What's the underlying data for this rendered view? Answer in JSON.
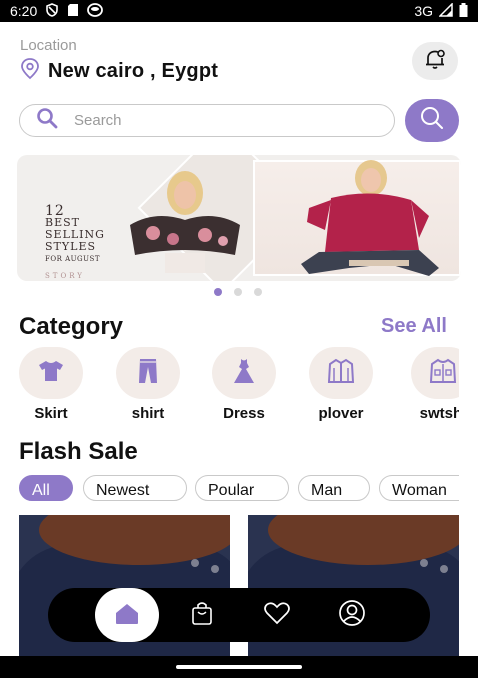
{
  "status_bar": {
    "time": "6:20",
    "network": "3G"
  },
  "header": {
    "location_label": "Location",
    "location_value": "New cairo , Eygpt"
  },
  "search": {
    "placeholder": "Search"
  },
  "banner": {
    "line1": "12",
    "line2": "BEST",
    "line3": "SELLING",
    "line4": "STYLES",
    "line5": "FOR AUGUST",
    "brand": "STORY",
    "slide_count": 3,
    "active_slide": 1
  },
  "category": {
    "title": "Category",
    "see_all": "See All",
    "items": [
      {
        "label": "Skirt",
        "icon": "tshirt-icon"
      },
      {
        "label": "shirt",
        "icon": "pants-icon"
      },
      {
        "label": "Dress",
        "icon": "dress-icon"
      },
      {
        "label": "plover",
        "icon": "jacket-icon"
      },
      {
        "label": "swtshi",
        "icon": "sweatshirt-icon"
      }
    ]
  },
  "flash_sale": {
    "title": "Flash Sale",
    "filters": [
      "All",
      "Newest",
      "Poular",
      "Man",
      "Woman"
    ],
    "active_filter": "All"
  },
  "bottom_nav": {
    "items": [
      "home-icon",
      "bag-icon",
      "heart-icon",
      "profile-icon"
    ],
    "active": "home-icon"
  },
  "colors": {
    "accent": "#8e79c8",
    "category_bg": "#f3ece8"
  }
}
